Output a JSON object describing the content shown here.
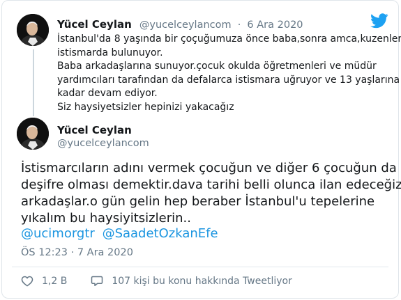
{
  "parent_tweet": {
    "display_name": "Yücel Ceylan",
    "handle": "@yucelceylancom",
    "separator": "·",
    "date": "6 Ara 2020",
    "lines": [
      "İstanbul'da 8 yaşında bir çoçuğumuza önce baba,sonra amca,kuzenler",
      "istismarda bulunuyor.",
      "Baba arkadaşlarına sunuyor.çocuk okulda öğretmenleri ve müdür",
      "yardımcıları tarafından da defalarca istismara uğruyor ve 13 yaşlarına",
      "kadar devam ediyor.",
      "Siz haysiyetsizler hepinizi yakacağız"
    ]
  },
  "reply_tweet": {
    "display_name": "Yücel Ceylan",
    "handle": "@yucelceylancom",
    "lines": [
      "İstismarcıların adını vermek çocuğun ve diğer 6 çocuğun da",
      "deşifre olması demektir.dava tarihi belli olunca ilan edeceğiz",
      "arkadaşlar.o gün gelin hep beraber İstanbul'u tepelerine",
      "yıkalım bu haysiyitsizlerin.."
    ],
    "mentions": [
      "@ucimorgtr",
      "@SaadetOzkanEfe"
    ],
    "timestamp": "ÖS 12:23 · 7 Ara 2020",
    "likes": "1,2 B",
    "discussion": "107 kişi bu konu hakkında Tweetliyor"
  },
  "icons": {
    "brand": "twitter-bird-icon",
    "like": "heart-icon",
    "reply": "speech-bubble-icon"
  },
  "colors": {
    "brand_blue": "#1da1f2",
    "mention_blue": "#1b95e0",
    "secondary_text": "#657786",
    "primary_text": "#14171a",
    "border": "#dfe5ea"
  }
}
